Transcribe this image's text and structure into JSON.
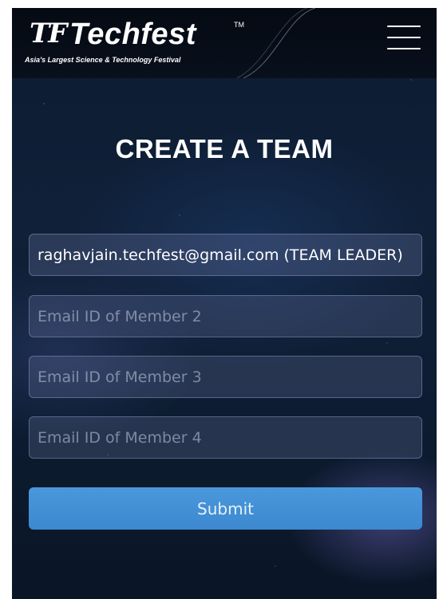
{
  "header": {
    "logo_mark": "TF",
    "logo_name": "Techfest",
    "logo_tm": "TM",
    "tagline": "Asia's Largest Science & Technology Festival"
  },
  "menu": {
    "icon": "hamburger-menu-icon"
  },
  "page": {
    "title": "CREATE A TEAM"
  },
  "form": {
    "leader_email_value": "raghavjain.techfest@gmail.com (TEAM LEADER)",
    "member2_placeholder": "Email ID of Member 2",
    "member3_placeholder": "Email ID of Member 3",
    "member4_placeholder": "Email ID of Member 4",
    "submit_label": "Submit"
  },
  "colors": {
    "background": "#0f2038",
    "header": "#050a13",
    "accent": "#4a98dc"
  }
}
